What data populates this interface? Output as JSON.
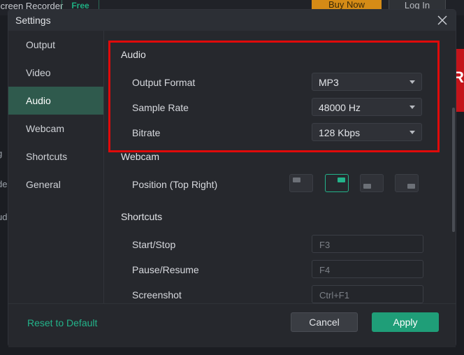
{
  "background_app": {
    "title": "Screen Recorder",
    "badge": "Free",
    "buy_label": "Buy Now",
    "login_label": "Log In",
    "red_text": "RE",
    "left_fragments": [
      "g",
      "de",
      "ud"
    ]
  },
  "dialog": {
    "title": "Settings",
    "close_icon": "close-icon"
  },
  "sidebar": {
    "items": [
      {
        "label": "Output",
        "active": false
      },
      {
        "label": "Video",
        "active": false
      },
      {
        "label": "Audio",
        "active": true
      },
      {
        "label": "Webcam",
        "active": false
      },
      {
        "label": "Shortcuts",
        "active": false
      },
      {
        "label": "General",
        "active": false
      }
    ]
  },
  "audio": {
    "title": "Audio",
    "output_format": {
      "label": "Output Format",
      "value": "MP3"
    },
    "sample_rate": {
      "label": "Sample Rate",
      "value": "48000 Hz"
    },
    "bitrate": {
      "label": "Bitrate",
      "value": "128 Kbps"
    }
  },
  "webcam": {
    "title": "Webcam",
    "position_label": "Position (Top Right)",
    "positions": [
      "Top Left",
      "Top Right",
      "Bottom Left",
      "Bottom Right"
    ],
    "selected_position": "Top Right"
  },
  "shortcuts": {
    "title": "Shortcuts",
    "items": [
      {
        "label": "Start/Stop",
        "value": "F3"
      },
      {
        "label": "Pause/Resume",
        "value": "F4"
      },
      {
        "label": "Screenshot",
        "value": "Ctrl+F1"
      }
    ]
  },
  "footer": {
    "reset_label": "Reset to Default",
    "cancel_label": "Cancel",
    "apply_label": "Apply"
  },
  "colors": {
    "accent": "#23b38a",
    "active_sidebar": "#2f5a4d",
    "highlight": "#e00a0a"
  }
}
